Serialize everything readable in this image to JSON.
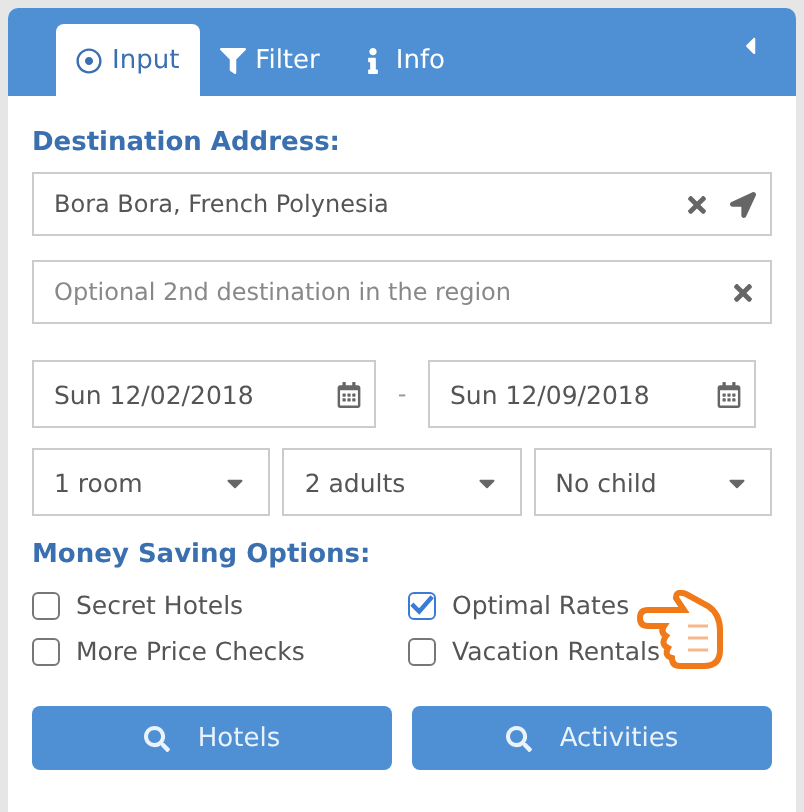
{
  "tabs": [
    {
      "label": "Input",
      "selected": true
    },
    {
      "label": "Filter",
      "selected": false
    },
    {
      "label": "Info",
      "selected": false
    }
  ],
  "destination": {
    "label": "Destination Address:",
    "value": "Bora Bora, French Polynesia",
    "second_placeholder": "Optional 2nd destination in the region"
  },
  "dates": {
    "check_in": "Sun 12/02/2018",
    "separator": "-",
    "check_out": "Sun 12/09/2018"
  },
  "selects": [
    "1 room",
    "2 adults",
    "No child"
  ],
  "options": {
    "label": "Money Saving Options:",
    "items": [
      {
        "label": "Secret Hotels",
        "checked": false
      },
      {
        "label": "Optimal Rates",
        "checked": true
      },
      {
        "label": "More Price Checks",
        "checked": false
      },
      {
        "label": "Vacation Rentals",
        "checked": false
      }
    ]
  },
  "buttons": [
    "Hotels",
    "Activities"
  ]
}
